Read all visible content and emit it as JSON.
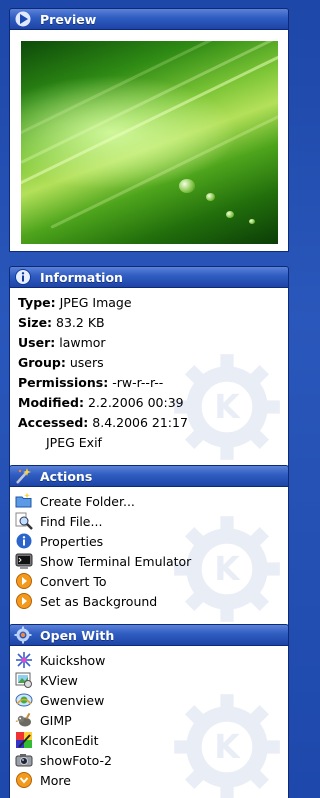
{
  "colors": {
    "background": "#2a57bb",
    "header": "#2f5cc0",
    "panel": "#ffffff"
  },
  "preview": {
    "title": "Preview",
    "icon": "play-arrow-icon",
    "image": "green-leaf-with-water-drops"
  },
  "information": {
    "title": "Information",
    "icon": "info-icon",
    "rows": [
      {
        "label": "Type:",
        "value": "JPEG Image"
      },
      {
        "label": "Size:",
        "value": "83.2 KB"
      },
      {
        "label": "User:",
        "value": "lawmor"
      },
      {
        "label": "Group:",
        "value": "users"
      },
      {
        "label": "Permissions:",
        "value": "-rw-r--r--"
      },
      {
        "label": "Modified:",
        "value": "2.2.2006 00:39"
      },
      {
        "label": "Accessed:",
        "value": "8.4.2006 21:17"
      }
    ],
    "extra": "JPEG Exif"
  },
  "actions": {
    "title": "Actions",
    "icon": "magic-wand-icon",
    "items": [
      {
        "label": "Create Folder...",
        "icon": "new-folder-icon"
      },
      {
        "label": "Find File...",
        "icon": "magnifier-icon"
      },
      {
        "label": "Properties",
        "icon": "info-icon"
      },
      {
        "label": "Show Terminal Emulator",
        "icon": "terminal-icon"
      },
      {
        "label": "Convert To",
        "icon": "orange-arrow-icon"
      },
      {
        "label": "Set as Background",
        "icon": "orange-arrow-icon"
      }
    ]
  },
  "open_with": {
    "title": "Open With",
    "icon": "gear-icon",
    "items": [
      {
        "label": "Kuickshow",
        "icon": "kuickshow-icon"
      },
      {
        "label": "KView",
        "icon": "kview-icon"
      },
      {
        "label": "Gwenview",
        "icon": "gwenview-icon"
      },
      {
        "label": "GIMP",
        "icon": "gimp-icon"
      },
      {
        "label": "KIconEdit",
        "icon": "kiconedit-icon"
      },
      {
        "label": "showFoto-2",
        "icon": "showfoto-icon"
      },
      {
        "label": "More",
        "icon": "orange-chevron-icon"
      }
    ]
  }
}
